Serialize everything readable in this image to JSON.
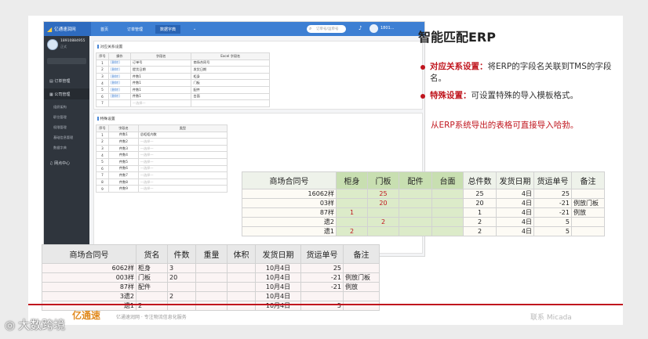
{
  "app": {
    "brand": "亿通速润网",
    "tabs": [
      "首页",
      "订单管理",
      "数据字典"
    ],
    "search_placeholder": "订单号/运单号",
    "user_short": "1801...",
    "sidebar": {
      "username": "18910884955",
      "role": "正式",
      "items": [
        "订单管理",
        "公司管理",
        "网点中心"
      ],
      "subitems": [
        "组织架构",
        "职位管理",
        "权限管理",
        "基础信息管理",
        "数据字典"
      ]
    },
    "panel1": {
      "title": "对应关系设置",
      "headers": [
        "序号",
        "操作",
        "字段名",
        "Excel 字段名"
      ],
      "rows": [
        [
          "1",
          "[删除]",
          "订单号",
          "商场合同号"
        ],
        [
          "2",
          "[删除]",
          "提货日期",
          "发货日期"
        ],
        [
          "3",
          "[删除]",
          "件数1",
          "柜身"
        ],
        [
          "4",
          "[删除]",
          "件数1",
          "门板"
        ],
        [
          "5",
          "[删除]",
          "件数1",
          "配件"
        ],
        [
          "6",
          "[删除]",
          "件数1",
          "台面"
        ],
        [
          "7",
          "",
          "—选择—",
          ""
        ]
      ]
    },
    "panel2": {
      "title": "特殊设置",
      "headers": [
        "序号",
        "字段名",
        "类型"
      ],
      "rows": [
        [
          "1",
          "件数1",
          "总柜柜内数"
        ],
        [
          "2",
          "件数2",
          "—选择—"
        ],
        [
          "3",
          "件数3",
          "—选择—"
        ],
        [
          "4",
          "件数4",
          "—选择—"
        ],
        [
          "5",
          "件数5",
          "—选择—"
        ],
        [
          "6",
          "件数6",
          "—选择—"
        ],
        [
          "7",
          "件数7",
          "—选择—"
        ],
        [
          "8",
          "件数8",
          "—选择—"
        ],
        [
          "9",
          "件数9",
          "—选择—"
        ]
      ]
    }
  },
  "slide": {
    "heading": "智能匹配ERP",
    "bullets": [
      {
        "label": "对应关系设置：",
        "text": "将ERP的字段名关联到TMS的字段名。"
      },
      {
        "label": "特殊设置：",
        "text": "可设置特殊的导入模板格式。"
      }
    ],
    "note": "从ERP系统导出的表格可直接导入哈勃。",
    "footer_logo": "亿通速",
    "footer_text": "亿通速润网 · 专注物流信息化服务",
    "footer_right": "联系 Micada",
    "watermark": "大数跨境"
  },
  "erp_table": {
    "headers": [
      "商场合同号",
      "柜身",
      "门板",
      "配件",
      "台面",
      "总件数",
      "发货日期",
      "货运单号",
      "备注"
    ],
    "rows": [
      [
        "16062样",
        "",
        "25",
        "",
        "",
        "25",
        "4日",
        "25",
        ""
      ],
      [
        "03样",
        "",
        "20",
        "",
        "",
        "20",
        "4日",
        "-21",
        "例放门板"
      ],
      [
        "87样",
        "1",
        "",
        "",
        "",
        "1",
        "4日",
        "-21",
        "例放"
      ],
      [
        "遗2",
        "",
        "2",
        "",
        "",
        "2",
        "4日",
        "5",
        ""
      ],
      [
        "遗1",
        "2",
        "",
        "",
        "",
        "2",
        "4日",
        "5",
        ""
      ]
    ]
  },
  "tms_table": {
    "headers": [
      "商场合同号",
      "货名",
      "件数",
      "重量",
      "体积",
      "发货日期",
      "货运单号",
      "备注"
    ],
    "rows": [
      [
        "6062样",
        "柜身",
        "3",
        "",
        "",
        "10月4日",
        "25",
        ""
      ],
      [
        "003样",
        "门板",
        "20",
        "",
        "",
        "10月4日",
        "-21",
        "例放门板"
      ],
      [
        "87样",
        "配件",
        "",
        "",
        "",
        "10月4日",
        "-21",
        "例放"
      ],
      [
        "3遗2",
        "",
        "2",
        "",
        "",
        "10月4日",
        "",
        ""
      ],
      [
        "遗1",
        "2",
        "",
        "",
        "",
        "10月4日",
        "5",
        ""
      ]
    ]
  }
}
